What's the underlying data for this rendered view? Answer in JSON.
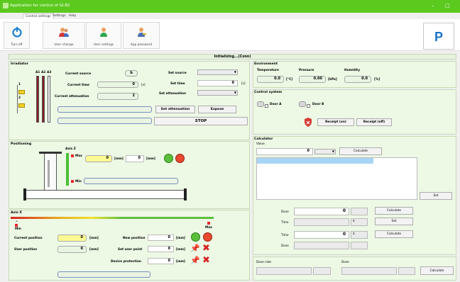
{
  "window": {
    "title": "Application for control of GI-B2",
    "minimize": "–",
    "maximize": "□"
  },
  "menu": [
    "Control settings",
    "Settings",
    "Help"
  ],
  "ribbon": {
    "buttons": [
      {
        "label": "Turn off",
        "icon": "power-icon"
      },
      {
        "label": "User change",
        "icon": "users-icon"
      },
      {
        "label": "User settings",
        "icon": "user-icon"
      },
      {
        "label": "App password",
        "icon": "user-key-icon"
      }
    ],
    "right_button": "P"
  },
  "status": "Initializing...(Conn)",
  "irradiator": {
    "title": "Irradiator",
    "source_headers": [
      "A1",
      "A2",
      "A3"
    ],
    "slot_labels": [
      "1",
      "2"
    ],
    "current_source_label": "Current source",
    "current_source": "b",
    "current_time_label": "Current time",
    "current_time": "0",
    "current_time_unit": "[s]",
    "current_attenuation_label": "Current attenuation",
    "current_attenuation": "2",
    "set_source_label": "Set source",
    "set_time_label": "Set time",
    "set_time": "0",
    "set_time_unit": "[s]",
    "set_attenuation_label": "Set attenuation",
    "set_attenuation_btn": "Set attenuation",
    "expose_btn": "Expose",
    "stop_btn": "STOP"
  },
  "positioning": {
    "title": "Positioning",
    "axis_z_label": "Axis Z",
    "max_label": "Max",
    "min_label": "Min",
    "z_value": "0",
    "z_unit": "[mm]",
    "z_target": "0",
    "z_target_unit": "[mm]"
  },
  "axis_x": {
    "title": "Axis X",
    "min_label": "Min",
    "max_label": "Max",
    "current_position_label": "Current position",
    "current_position": "0",
    "unit": "[mm]",
    "user_position_label": "User position",
    "user_position": "0",
    "new_position_label": "New position",
    "new_position": "0",
    "set_user_point_label": "Set user point",
    "set_user_point": "0",
    "device_protection_label": "Device protection",
    "device_protection": "0"
  },
  "environment": {
    "title": "Environment",
    "temperature_label": "Temperature",
    "temperature": "0.0",
    "temperature_unit": "[°C]",
    "pressure_label": "Pressure",
    "pressure": "0.00",
    "pressure_unit": "[kPa]",
    "humidity_label": "Humidity",
    "humidity": "0.0",
    "humidity_unit": "[%]"
  },
  "control_system": {
    "title": "Control system",
    "door_a": "Door A",
    "door_b": "Door B",
    "receipt_on": "Receipt (on)",
    "receipt_off": "Receipt (off)"
  },
  "calculator": {
    "title": "Calculator",
    "value_label": "Value",
    "value": "0",
    "calculate_btn": "Calculate",
    "set_btn": "Set",
    "dose_label": "Dose",
    "dose_value": "0",
    "time_label": "Time",
    "time_unit": "s",
    "time_value": "0",
    "dose2_label": "Dose",
    "dose_rate_label": "Dose rate",
    "dose_label2": "Dose"
  },
  "colors": {
    "titlebar": "#5cc91f",
    "panel": "#edf8e5",
    "yellow_field": "#fbfb93",
    "selection": "#a8d5f5"
  }
}
